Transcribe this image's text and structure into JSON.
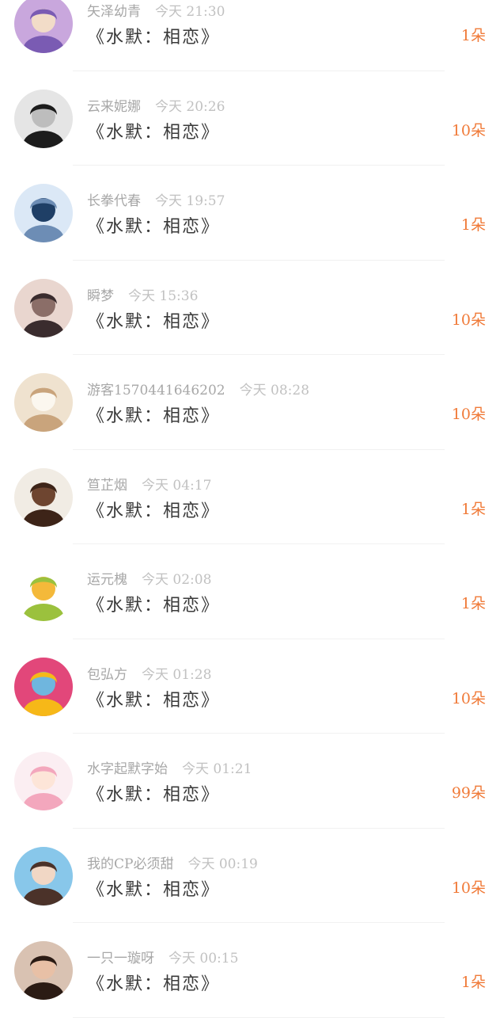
{
  "accent_color": "#f07a38",
  "gift_records": [
    {
      "user": "矢泽幼青",
      "time": "今天 21:30",
      "title": "《水默：相恋》",
      "count": "1朵",
      "avatar_icon": "avatar-boy-purple-icon",
      "avatar_colors": [
        "#c9a7dd",
        "#7a5bb3",
        "#f2dcc8"
      ]
    },
    {
      "user": "云来妮娜",
      "time": "今天 20:26",
      "title": "《水默：相恋》",
      "count": "10朵",
      "avatar_icon": "avatar-man-bw-icon",
      "avatar_colors": [
        "#e5e5e5",
        "#1c1c1c",
        "#bdbdbd"
      ]
    },
    {
      "user": "长拳代春",
      "time": "今天 19:57",
      "title": "《水默：相恋》",
      "count": "1朵",
      "avatar_icon": "avatar-tree-blue-icon",
      "avatar_colors": [
        "#dbe8f6",
        "#6d8db5",
        "#1f3f66"
      ]
    },
    {
      "user": "瞬梦",
      "time": "今天 15:36",
      "title": "《水默：相恋》",
      "count": "10朵",
      "avatar_icon": "avatar-anime-couple-icon",
      "avatar_colors": [
        "#e9d6cf",
        "#3a2c2e",
        "#8b6e68"
      ]
    },
    {
      "user": "游客1570441646202",
      "time": "今天 08:28",
      "title": "《水默：相恋》",
      "count": "10朵",
      "avatar_icon": "avatar-cat-icon",
      "avatar_colors": [
        "#efe2cf",
        "#c9a47c",
        "#fbf7ef"
      ]
    },
    {
      "user": "笪芷烟",
      "time": "今天 04:17",
      "title": "《水默：相恋》",
      "count": "1朵",
      "avatar_icon": "avatar-dog-icon",
      "avatar_colors": [
        "#f1ece4",
        "#3d2418",
        "#6e4530"
      ]
    },
    {
      "user": "运元槐",
      "time": "今天 02:08",
      "title": "《水默：相恋》",
      "count": "1朵",
      "avatar_icon": "avatar-green-pear-icon",
      "avatar_colors": [
        "#ffffff",
        "#9bc13d",
        "#f4b93a"
      ]
    },
    {
      "user": "包弘方",
      "time": "今天 01:28",
      "title": "《水默：相恋》",
      "count": "10朵",
      "avatar_icon": "avatar-yellow-block-icon",
      "avatar_colors": [
        "#e2477a",
        "#f6b818",
        "#6fb6de"
      ]
    },
    {
      "user": "水字起默字始",
      "time": "今天 01:21",
      "title": "《水默：相恋》",
      "count": "99朵",
      "avatar_icon": "avatar-pink-girl-icon",
      "avatar_colors": [
        "#fbeef2",
        "#f3a7bd",
        "#fde5d8"
      ]
    },
    {
      "user": "我的CP必须甜",
      "time": "今天 00:19",
      "title": "《水默：相恋》",
      "count": "10朵",
      "avatar_icon": "avatar-school-girl-icon",
      "avatar_colors": [
        "#88c7ea",
        "#4b3229",
        "#f1d7c5"
      ]
    },
    {
      "user": "一只一璇呀",
      "time": "今天 00:15",
      "title": "《水默：相恋》",
      "count": "1朵",
      "avatar_icon": "avatar-woman-photo-icon",
      "avatar_colors": [
        "#d9c2b2",
        "#2b1b14",
        "#e8c0a6"
      ]
    }
  ]
}
